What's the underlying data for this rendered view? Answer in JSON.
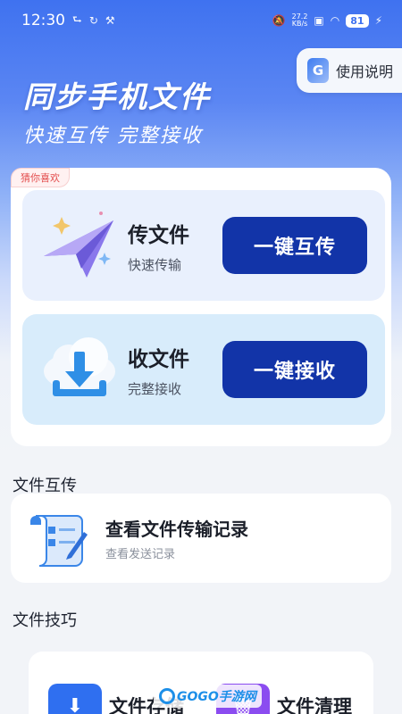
{
  "status_bar": {
    "time": "12:30",
    "left_icons": [
      "usb-icon",
      "sync-icon",
      "tools-icon"
    ],
    "net_speed_value": "27.2",
    "net_speed_unit": "KB/s",
    "battery": "81"
  },
  "help": {
    "label": "使用说明"
  },
  "hero": {
    "title": "同步手机文件",
    "subtitle": "快速互传 完整接收"
  },
  "tag": "猜你喜欢",
  "send": {
    "title": "传文件",
    "subtitle": "快速传输",
    "button": "一键互传"
  },
  "receive": {
    "title": "收文件",
    "subtitle": "完整接收",
    "button": "一键接收"
  },
  "sections": {
    "transfer": "文件互传",
    "tips": "文件技巧"
  },
  "history": {
    "title": "查看文件传输记录",
    "subtitle": "查看发送记录"
  },
  "tips": [
    {
      "label": "文件存储",
      "icon": "download-folder-icon",
      "color": "#2f6ff0"
    },
    {
      "label": "文件清理",
      "icon": "trash-folder-icon",
      "color": "#8b4cf0"
    }
  ],
  "watermark": "GOGO手游网",
  "colors": {
    "primary_button": "#1234a8",
    "hero": "#3f72f0"
  }
}
